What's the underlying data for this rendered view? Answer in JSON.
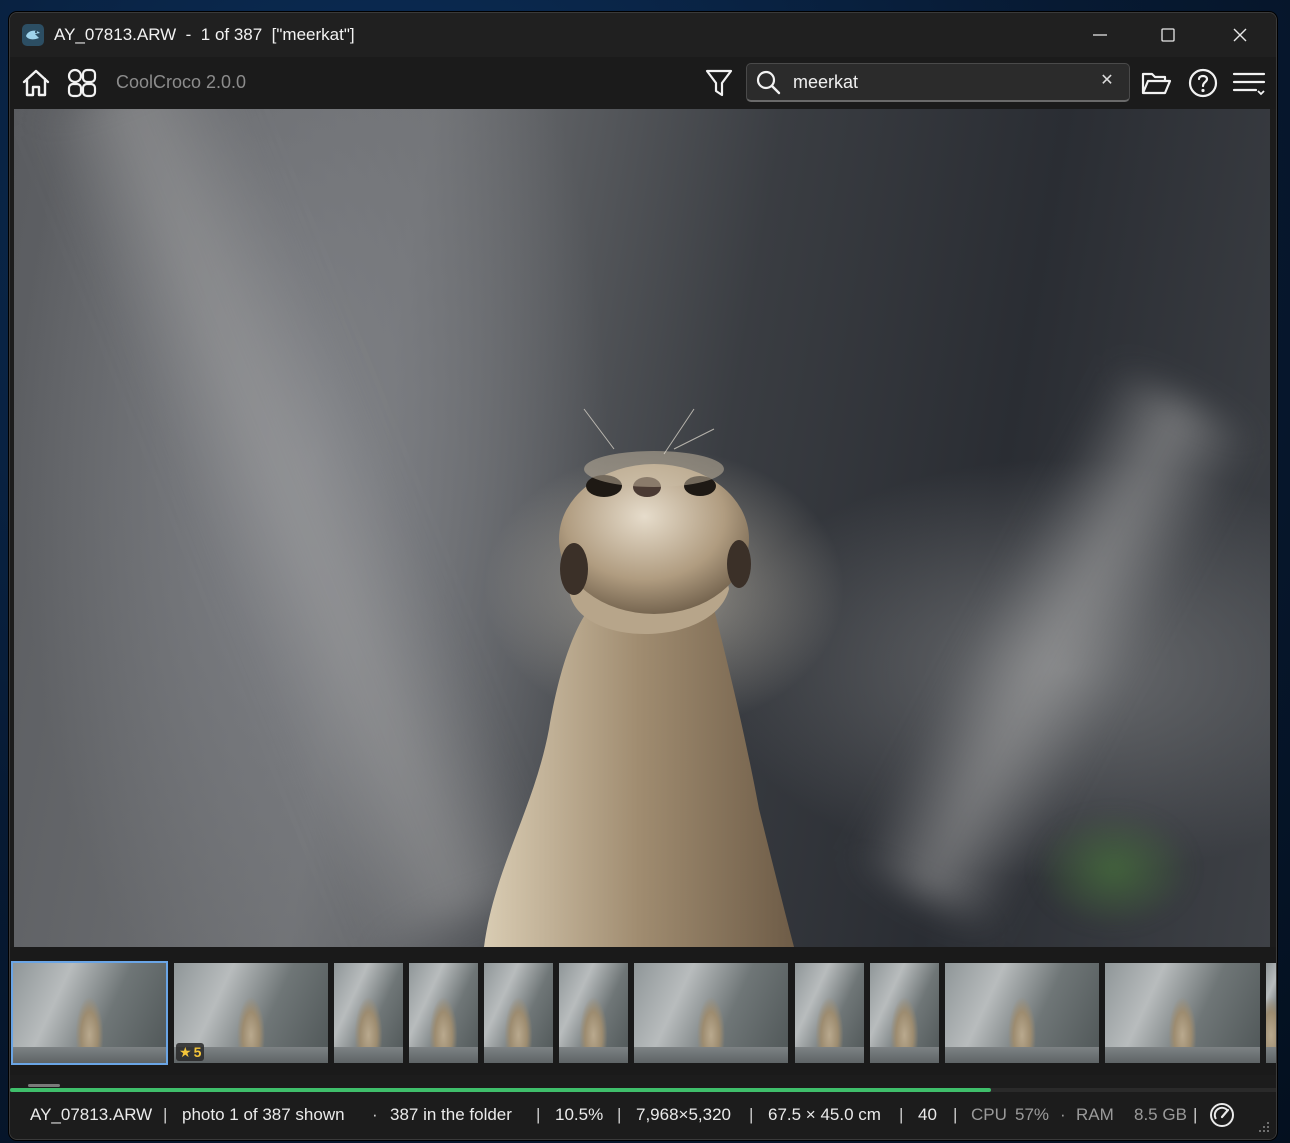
{
  "window": {
    "title": "AY_07813.ARW  -  1 of 387  [\"meerkat\"]"
  },
  "toolbar": {
    "app_name": "CoolCroco 2.0.0",
    "search": {
      "value": "meerkat",
      "placeholder": ""
    },
    "clear_label": "✕",
    "icons": [
      "home-icon",
      "grid-view-icon",
      "filter-icon",
      "search-icon",
      "open-folder-icon",
      "help-icon",
      "menu-icon"
    ]
  },
  "photo": {
    "subject": "meerkat"
  },
  "filmstrip": {
    "thumbnails": [
      {
        "selected": true
      },
      {
        "rating": "5"
      },
      {},
      {},
      {},
      {},
      {},
      {},
      {},
      {},
      {}
    ]
  },
  "progress": {
    "fraction": 0.775
  },
  "status": {
    "filename": "AY_07813.ARW",
    "sep1": "|",
    "shown": "photo 1 of 387 shown",
    "dot": "·",
    "folder": "387 in the folder",
    "sep2": "|",
    "zoom": "10.5%",
    "sep3": "|",
    "dimensions": "7,968×5,320",
    "sep4": "|",
    "print_size": "67.5 × 45.0 cm",
    "sep5": "|",
    "number": "40",
    "sep6": "|",
    "cpu_label": "CPU",
    "cpu_value": "57%",
    "dot2": "·",
    "ram_label": "RAM",
    "ram_value": "8.5 GB",
    "sep7": "|"
  },
  "colors": {
    "accent_progress": "#3fbf6b",
    "selection_outline": "#6aa5e6",
    "rating_star": "#f5c63a"
  }
}
